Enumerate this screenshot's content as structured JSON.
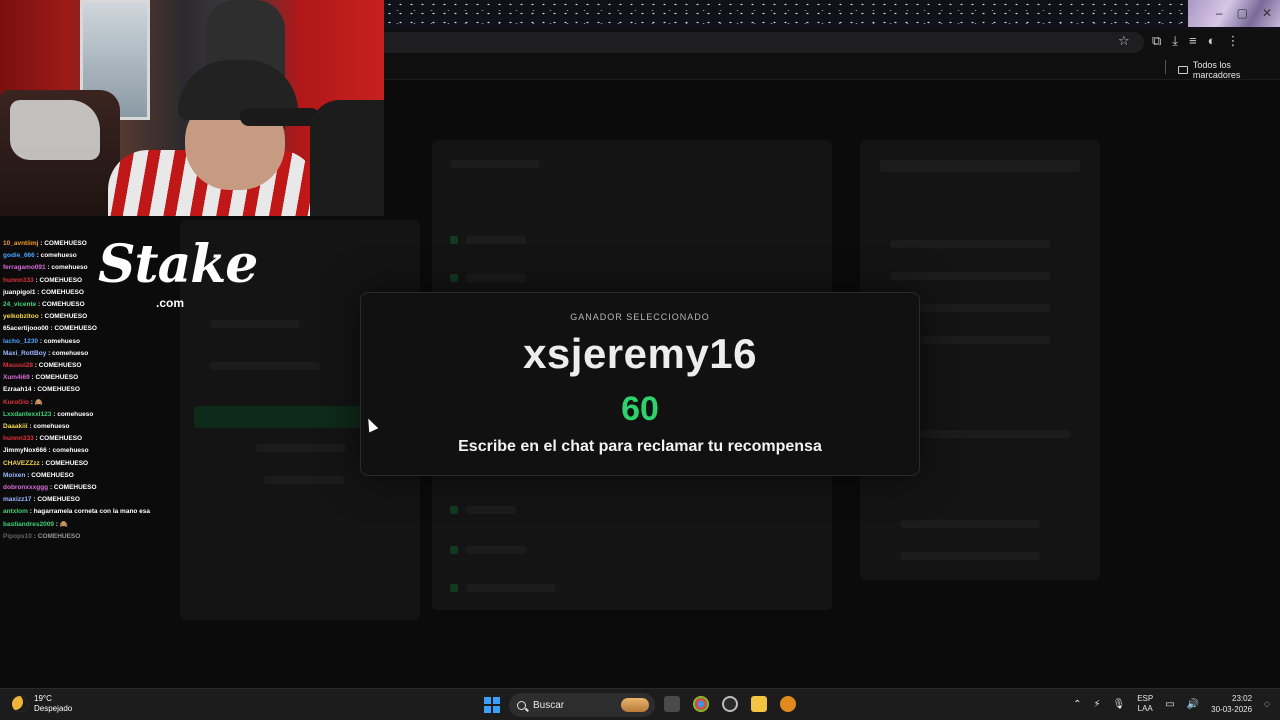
{
  "browser": {
    "bookmarks_folder_label": "Todos los marcadores",
    "window_controls": [
      "–",
      "▢",
      "✕"
    ]
  },
  "overlay": {
    "brand": "Stake",
    "brand_suffix": ".com"
  },
  "chat": [
    {
      "user": "10_avntiimj",
      "color": "#f39a2b",
      "msg": "COMEHUESO"
    },
    {
      "user": "godie_666",
      "color": "#4aa3ff",
      "msg": "comehueso"
    },
    {
      "user": "ferragamo091",
      "color": "#d36bd8",
      "msg": "comehueso"
    },
    {
      "user": "hunnn333",
      "color": "#e0323a",
      "msg": "COMEHUESO"
    },
    {
      "user": "juanpigol1",
      "color": "#ffffff",
      "msg": "COMEHUESO"
    },
    {
      "user": "24_vicente",
      "color": "#3fd17a",
      "msg": "COMEHUESO"
    },
    {
      "user": "yeikobzitoo",
      "color": "#f5d94a",
      "msg": "COMEHUESO"
    },
    {
      "user": "65acertijooo00",
      "color": "#ffffff",
      "msg": "COMEHUESO"
    },
    {
      "user": "lacho_1230",
      "color": "#4aa3ff",
      "msg": "comehueso"
    },
    {
      "user": "Maxi_RottBoy",
      "color": "#9bb7ff",
      "msg": "comehueso"
    },
    {
      "user": "Mauuui28",
      "color": "#e0323a",
      "msg": "COMEHUESO"
    },
    {
      "user": "Xum4i69",
      "color": "#d36bd8",
      "msg": "COMEHUESO"
    },
    {
      "user": "Ezraah14",
      "color": "#ffffff",
      "msg": "COMEHUESO"
    },
    {
      "user": "KuroGio",
      "color": "#e0323a",
      "msg": "🙈"
    },
    {
      "user": "Lxxdantexxl123",
      "color": "#3fd17a",
      "msg": "comehueso"
    },
    {
      "user": "Daaakiii",
      "color": "#f5d94a",
      "msg": "comehueso"
    },
    {
      "user": "hunnn333",
      "color": "#e0323a",
      "msg": "COMEHUESO"
    },
    {
      "user": "JimmyNox666",
      "color": "#ffffff",
      "msg": "comehueso"
    },
    {
      "user": "CHAVEZZzz",
      "color": "#f5d94a",
      "msg": "COMEHUESO"
    },
    {
      "user": "Moixen",
      "color": "#9bb7ff",
      "msg": "COMEHUESO"
    },
    {
      "user": "dobronxxxggg",
      "color": "#d36bd8",
      "msg": "COMEHUESO"
    },
    {
      "user": "maxizz17",
      "color": "#9bb7ff",
      "msg": "COMEHUESO"
    },
    {
      "user": "antxlom",
      "color": "#3fd17a",
      "msg": "hagarramela corneta con la mano esa"
    },
    {
      "user": "bastiandres2009",
      "color": "#3fd17a",
      "msg": "🙈"
    },
    {
      "user": "Pipops10",
      "color": "#aaaaaa",
      "msg": "COMEHUESO"
    }
  ],
  "modal": {
    "label": "GANADOR SELECCIONADO",
    "winner": "xsjeremy16",
    "number": "60",
    "instruction": "Escribe en el chat para reclamar tu recompensa"
  },
  "taskbar": {
    "temperature": "19°C",
    "weather": "Despejado",
    "search_placeholder": "Buscar",
    "lang_line1": "ESP",
    "lang_line2": "LAA",
    "time": "23:02",
    "date": "30-03-2026"
  }
}
